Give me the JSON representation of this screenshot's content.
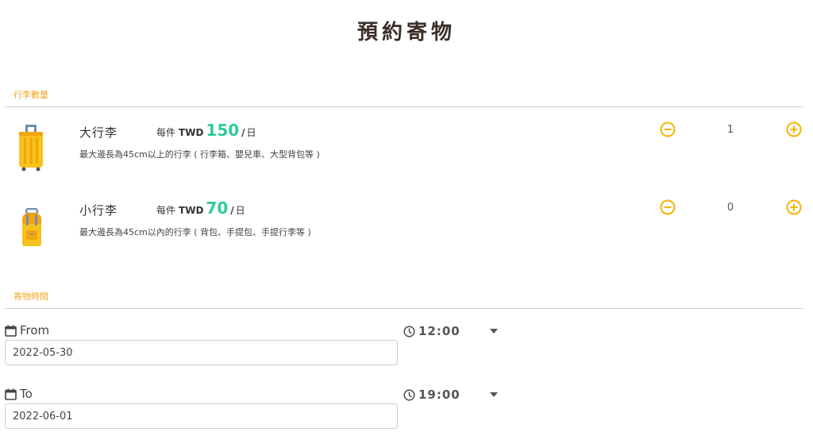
{
  "page": {
    "title": "預約寄物"
  },
  "sections": {
    "luggage_label": "行李數量",
    "time_label": "寄物時間"
  },
  "items": [
    {
      "name": "大行李",
      "per_label": "每件",
      "currency": "TWD",
      "price": "150",
      "slash": "/",
      "unit": "日",
      "description": "最大邊長為45cm以上的行李 ( 行李箱、嬰兒車、大型背包等 )",
      "quantity": "1",
      "icon": "suitcase-icon"
    },
    {
      "name": "小行李",
      "per_label": "每件",
      "currency": "TWD",
      "price": "70",
      "slash": "/",
      "unit": "日",
      "description": "最大邊長為45cm以內的行李 ( 背包、手提包、手提行李等 )",
      "quantity": "0",
      "icon": "backpack-icon"
    }
  ],
  "from": {
    "label": "From",
    "date": "2022-05-30",
    "time": "12:00"
  },
  "to": {
    "label": "To",
    "date": "2022-06-01",
    "time": "19:00"
  },
  "colors": {
    "accent": "#f5a623",
    "price": "#2ecc9a",
    "button": "#f5b400",
    "title": "#3a2f28"
  }
}
